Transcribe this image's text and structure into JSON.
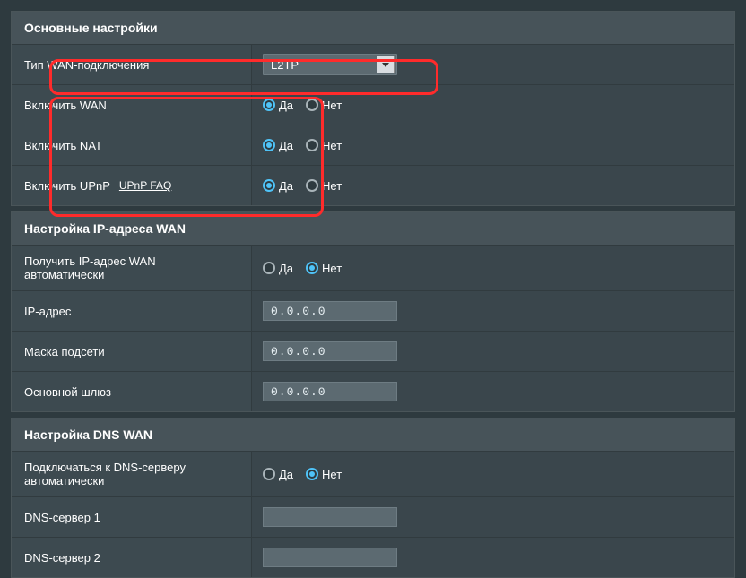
{
  "main_settings": {
    "header": "Основные настройки",
    "wan_type_label": "Тип WAN-подключения",
    "wan_type_value": "L2TP",
    "enable_wan_label": "Включить WAN",
    "enable_nat_label": "Включить NAT",
    "enable_upnp_label": "Включить UPnP",
    "upnp_faq_label": "UPnP  FAQ",
    "yes": "Да",
    "no": "Нет"
  },
  "ip_settings": {
    "header": "Настройка IP-адреса WAN",
    "auto_ip_label": "Получить IP-адрес WAN автоматически",
    "ip_label": "IP-адрес",
    "ip_value": "0.0.0.0",
    "mask_label": "Маска подсети",
    "mask_value": "0.0.0.0",
    "gateway_label": "Основной шлюз",
    "gateway_value": "0.0.0.0"
  },
  "dns_settings": {
    "header": "Настройка DNS WAN",
    "auto_dns_label": "Подключаться к DNS-серверу автоматически",
    "dns1_label": "DNS-сервер 1",
    "dns1_value": "",
    "dns2_label": "DNS-сервер 2",
    "dns2_value": ""
  }
}
